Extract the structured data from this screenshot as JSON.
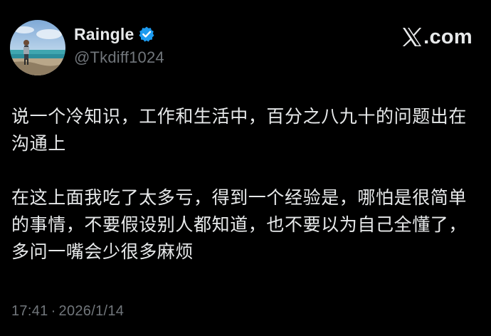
{
  "author": {
    "display_name": "Raingle",
    "handle": "@Tkdiff1024",
    "verified": true
  },
  "brand": {
    "label": ".com",
    "logo_icon": "x-logo-icon"
  },
  "tweet": {
    "paragraphs": [
      "说一个冷知识，工作和生活中，百分之八九十的问题出在沟通上",
      "在这上面我吃了太多亏，得到一个经验是，哪怕是很简单的事情，不要假设别人都知道，也不要以为自己全懂了，多问一嘴会少很多麻烦"
    ]
  },
  "meta": {
    "time": "17:41",
    "separator": "·",
    "date": "2026/1/14"
  },
  "colors": {
    "background": "#000000",
    "text": "#e7e9ea",
    "muted": "#71767b",
    "verified_blue": "#1d9bf0"
  }
}
